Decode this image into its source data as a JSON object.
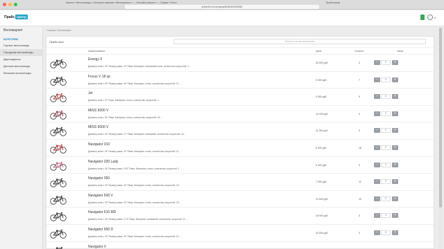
{
  "browser": {
    "tab_left": "Каталог «Велосипеды» | Интернет-магазин «Велокаталог» — «Онлайн-каталог» — Сервис «Тест»",
    "tab_right": "Пробелярем",
    "url": "pricecert.ru/company/8c6f/403245345",
    "colors": {
      "close": "#ff5f57",
      "minimize": "#febc2e",
      "zoom": "#28c840"
    }
  },
  "app": {
    "logo_text": "Прайс",
    "logo_badge": "Центр",
    "accent": "#1fa5c9"
  },
  "sidebar": {
    "title": "Веломаркет",
    "heading": "Категории",
    "items": [
      {
        "label": "Горные велосипеды",
        "active": false
      },
      {
        "label": "Городские велосипеды",
        "active": true
      },
      {
        "label": "Двухподвесы",
        "active": false
      },
      {
        "label": "Детские велосипеды",
        "active": false
      },
      {
        "label": "Женские велосипеды",
        "active": false
      }
    ]
  },
  "breadcrumb": "Главная / Веломаркет",
  "panel": {
    "price_label": "Прайс-лист",
    "search_placeholder": "Поиск по всем категориям",
    "columns": {
      "name": "Наименование",
      "price": "Цена",
      "stock": "Остаток",
      "order": "Заказ"
    }
  },
  "products": [
    {
      "name": "Energy II",
      "desc": "Диаметр колес: 26\" Размер рамы: 16\" Рама: Материал: алюминий/сталь, количество скоростей: 3 ...",
      "price": "25 000 руб.",
      "stock": "3",
      "qty": "0",
      "frame_color": "#222222"
    },
    {
      "name": "Focus V 18 sp",
      "desc": "Диаметр колес: 26\" Размер рамы: 18\" Рама: Материал: сталь, количество скоростей: 21 ...",
      "price": "9 000 руб.",
      "stock": "7",
      "qty": "0",
      "frame_color": "#222222"
    },
    {
      "name": "Jet",
      "desc": "Диаметр колес: 20\" Рама: Материал: сталь, количество скоростей: 1 ...",
      "price": "4 000 руб.",
      "stock": "9",
      "qty": "0",
      "frame_color": "#b03030"
    },
    {
      "name": "MISS 5000 V",
      "desc": "Диаметр колес: 26\" Рама: Материал: сталь, количество скоростей: 18 ...",
      "price": "10 000 руб.",
      "stock": "3",
      "qty": "0",
      "frame_color": "#8a2a3a"
    },
    {
      "name": "MISS 6000 V",
      "desc": "Диаметр колес: 26\" Размер рамы: 17\" Рама: Материал: алюминий, количество скоростей: 18 ...",
      "price": "11 000 руб.",
      "stock": "3",
      "qty": "0",
      "frame_color": "#222222"
    },
    {
      "name": "Navigator 310",
      "desc": "Диаметр колес: 26\" Размер рамы: 20\" Рама: Материал: сталь, количество скоростей: 21 ...",
      "price": "6 000 руб.",
      "stock": "16",
      "qty": "0",
      "frame_color": "#b02020"
    },
    {
      "name": "Navigator 320 Lady",
      "desc": "Диаметр колес: 26\" Размер рамы: 19.5\" Рама: Материал: сталь, количество скоростей: 1 ...",
      "price": "6 300 руб.",
      "stock": "3",
      "qty": "0",
      "frame_color": "#c05070"
    },
    {
      "name": "Navigator 350",
      "desc": "Диаметр колес: 26\" Размер рамы: 20\" Рама: Материал: сталь, количество скоростей: 18 ...",
      "price": "7 000 руб.",
      "stock": "12",
      "qty": "0",
      "frame_color": "#222222"
    },
    {
      "name": "Navigator 500 V",
      "desc": "Диаметр колес: 26\" Размер рамы: 20\" Рама: Материал: сталь, количество скоростей: 18 ...",
      "price": "10 500 руб.",
      "stock": "10",
      "qty": "0",
      "frame_color": "#222222"
    },
    {
      "name": "Navigator 610 MD",
      "desc": "Диаметр колес: 26\" Размер рамы: 17.5\" Рама: Материал: алюминий, количество скоростей: 21 ...",
      "price": "16 000 руб.",
      "stock": "3",
      "qty": "0",
      "frame_color": "#222222"
    },
    {
      "name": "Navigator 900 D",
      "desc": "Диаметр колес: 26\" Размер рамы: 20\" Рама: Материал: сталь, количество скоростей: 21 ...",
      "price": "24 000 руб.",
      "stock": "3",
      "qty": "0",
      "frame_color": "#222222"
    },
    {
      "name": "Navigator V",
      "desc": "",
      "price": "",
      "stock": "",
      "qty": "",
      "frame_color": "#222222"
    }
  ],
  "stepper": {
    "minus": "−",
    "plus": "+"
  },
  "header_icons": [
    "document-icon",
    "user-icon",
    "chevron-down-icon"
  ]
}
